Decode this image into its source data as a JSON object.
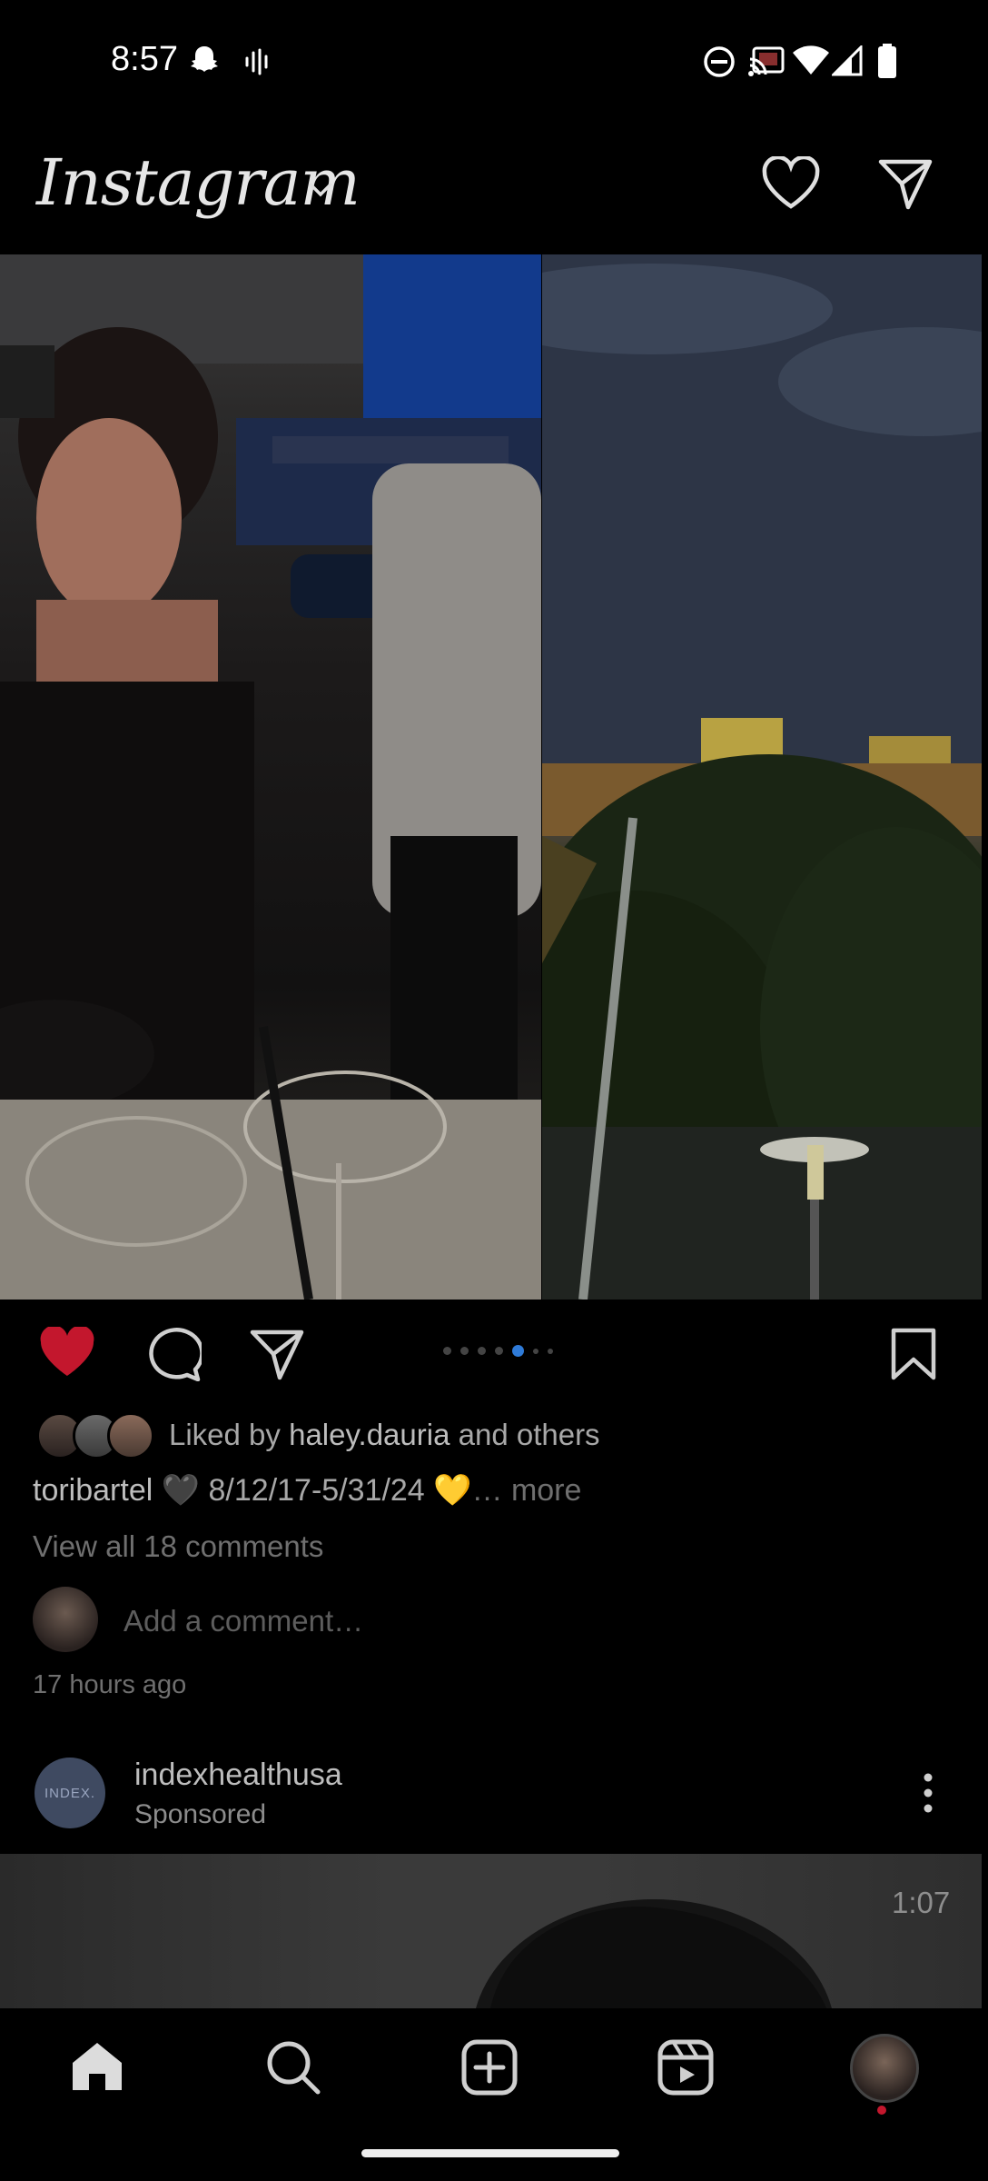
{
  "status_bar": {
    "time": "8:57",
    "left_icons": [
      "snapchat-icon",
      "voice-waveform-icon"
    ],
    "right_icons": [
      "do-not-disturb-icon",
      "cast-icon",
      "wifi-icon",
      "cell-signal-icon",
      "battery-icon"
    ]
  },
  "header": {
    "logo": "Instagram",
    "chevron": "chevron-down-icon",
    "actions": [
      "heart-icon",
      "direct-message-icon"
    ]
  },
  "post": {
    "carousel": {
      "count": 7,
      "active_index": 3
    },
    "actions": {
      "like": "heart-filled-icon",
      "comment": "comment-icon",
      "share": "share-icon",
      "save": "bookmark-icon",
      "like_color": "#c3172d"
    },
    "liked_by_prefix": "Liked by",
    "liked_by_user": "haley.dauria",
    "liked_by_suffix": "and others",
    "caption_user": "toribartel",
    "caption_text": "🖤 8/12/17-5/31/24 💛",
    "caption_more": "… more",
    "view_comments": "View all 18 comments",
    "add_comment_placeholder": "Add a comment…",
    "time_ago": "17 hours ago"
  },
  "sponsored_post": {
    "avatar_text": "INDEX.",
    "username": "indexhealthusa",
    "subtitle": "Sponsored",
    "menu": "more-options-icon",
    "video_timer": "1:07"
  },
  "bottom_nav": {
    "items": [
      "home-icon",
      "search-icon",
      "create-icon",
      "reels-icon",
      "profile-avatar"
    ],
    "active": "home-icon",
    "notification_dot_color": "#c3172d"
  }
}
